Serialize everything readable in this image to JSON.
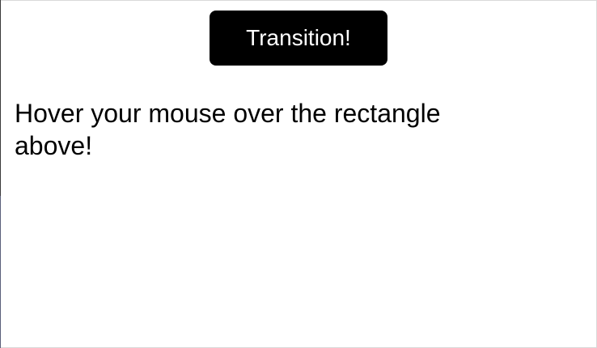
{
  "demo": {
    "button_label": "Transition!",
    "instruction": "Hover your mouse over the rectangle above!"
  }
}
